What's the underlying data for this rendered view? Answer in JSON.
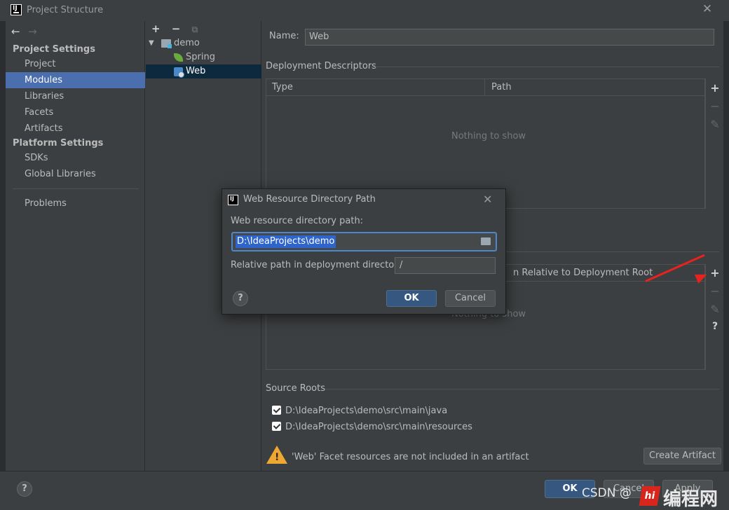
{
  "window": {
    "title": "Project Structure",
    "close_glyph": "✕"
  },
  "nav": {
    "back": "←",
    "forward": "→"
  },
  "sidebar": {
    "section1": "Project Settings",
    "items1": [
      "Project",
      "Modules",
      "Libraries",
      "Facets",
      "Artifacts"
    ],
    "section2": "Platform Settings",
    "items2": [
      "SDKs",
      "Global Libraries"
    ],
    "problems": "Problems",
    "selected": "Modules"
  },
  "tree": {
    "tools": {
      "add": "+",
      "remove": "−",
      "copy": "⧉"
    },
    "root": "demo",
    "children": [
      "Spring",
      "Web"
    ],
    "selected": "Web"
  },
  "main": {
    "name_label": "Name:",
    "name_value": "Web",
    "deployment_title": "Deployment Descriptors",
    "desc_table": {
      "col_type": "Type",
      "col_path": "Path",
      "empty": "Nothing to show"
    },
    "web_roots_table": {
      "col_relative": "n Relative to Deployment Root",
      "empty": "Nothing to show"
    },
    "tools": {
      "add": "+",
      "remove": "−",
      "edit": "✎",
      "help": "?"
    },
    "source_roots_title": "Source Roots",
    "source_roots": [
      "D:\\IdeaProjects\\demo\\src\\main\\java",
      "D:\\IdeaProjects\\demo\\src\\main\\resources"
    ],
    "warning_text": "'Web' Facet resources are not included in an artifact",
    "warning_glyph": "!",
    "create_artifact": "Create Artifact"
  },
  "bottom": {
    "help": "?",
    "ok": "OK",
    "cancel": "Cancel",
    "apply": "Apply"
  },
  "dialog": {
    "title": "Web Resource Directory Path",
    "close_glyph": "✕",
    "path_label": "Web resource directory path:",
    "path_value": "D:\\IdeaProjects\\demo",
    "relative_label": "Relative path in deployment directory:",
    "relative_value": "/",
    "help": "?",
    "ok": "OK",
    "cancel": "Cancel"
  },
  "watermark": {
    "csdn": "CSDN @",
    "logo": "hi",
    "site": "编程网"
  },
  "colors": {
    "selection": "#4b6eaf",
    "primary_button": "#365880",
    "warning": "#f0a732",
    "arrow": "#e8231f"
  }
}
